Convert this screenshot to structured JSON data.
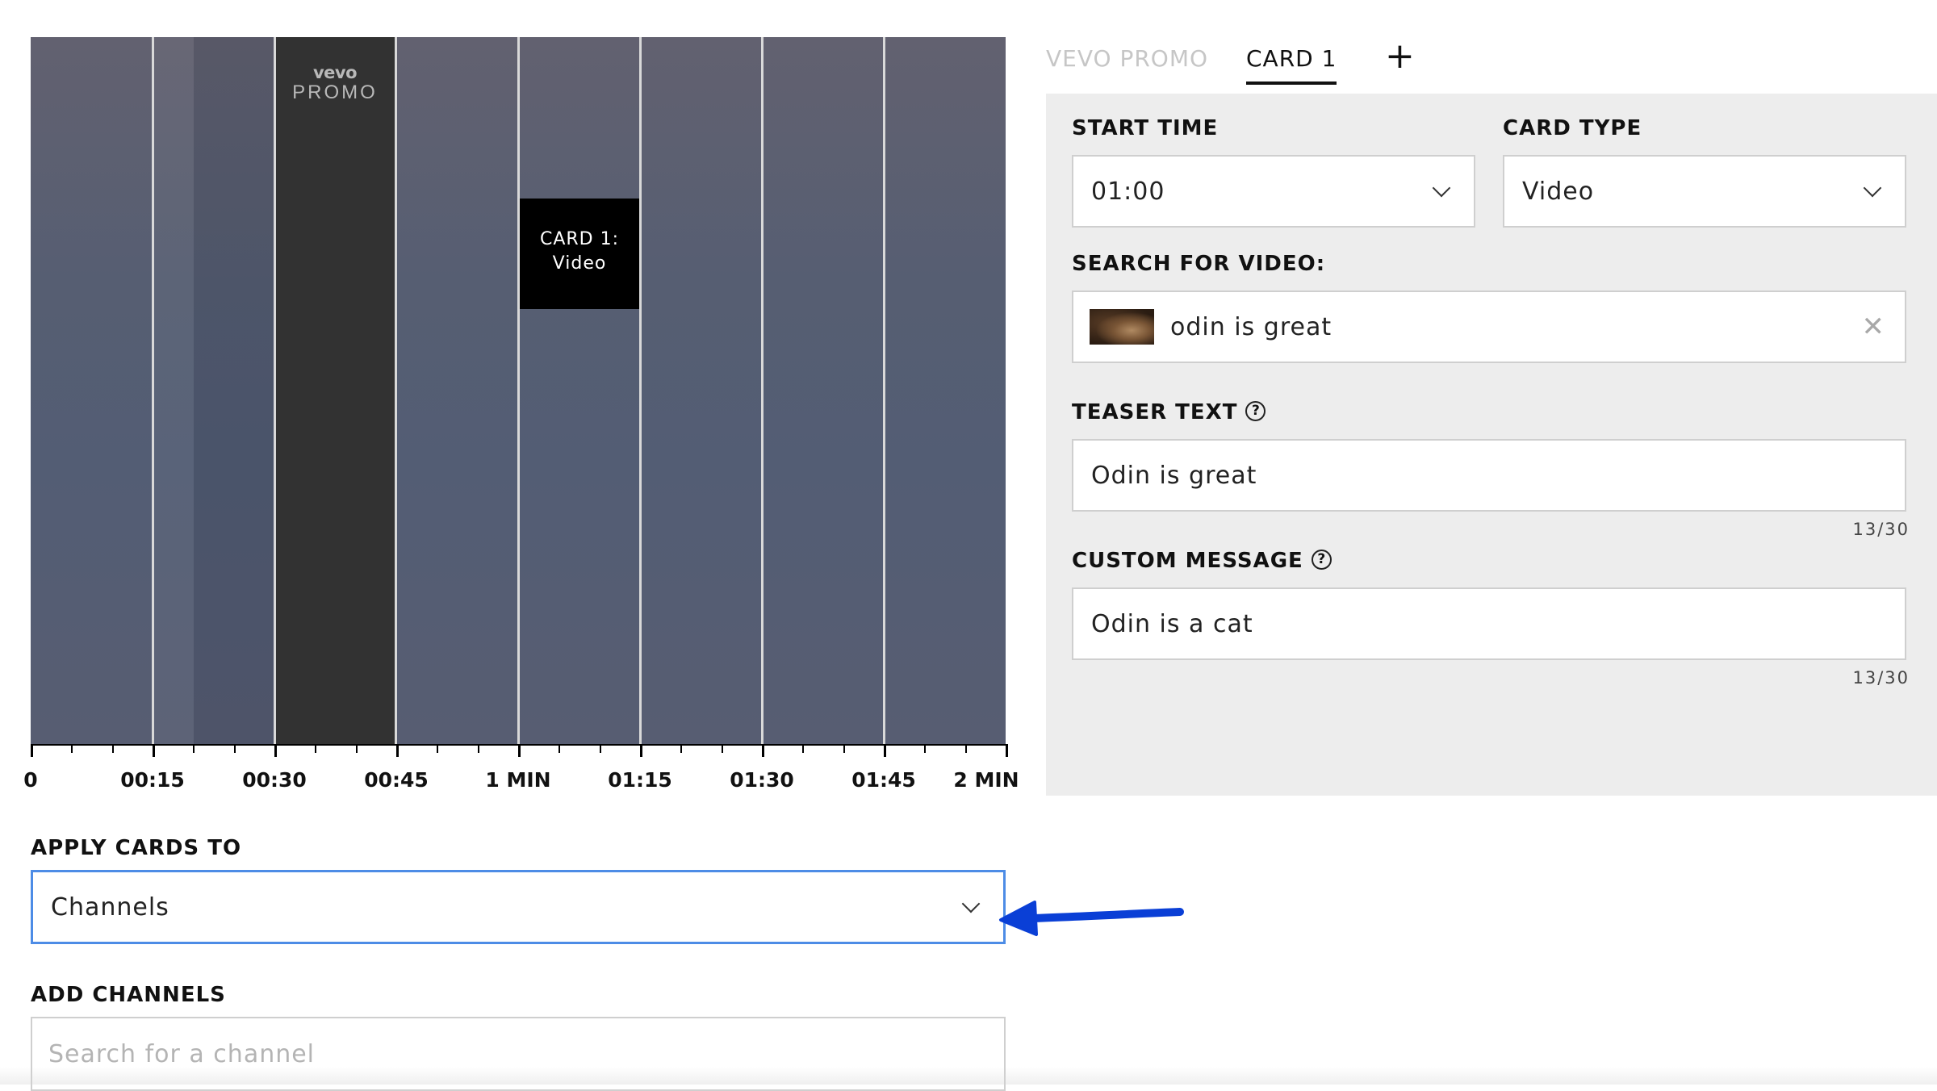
{
  "timeline": {
    "promo_brand": "vevo",
    "promo_word": "PROMO",
    "card_marker_line1": "CARD 1:",
    "card_marker_line2": "Video",
    "ticks": [
      "0",
      "00:15",
      "00:30",
      "00:45",
      "1 MIN",
      "01:15",
      "01:30",
      "01:45",
      "2 MIN"
    ]
  },
  "apply_cards": {
    "label": "APPLY CARDS TO",
    "value": "Channels"
  },
  "add_channels": {
    "label": "ADD CHANNELS",
    "placeholder": "Search for a channel"
  },
  "tabs": {
    "items": [
      {
        "label": "VEVO PROMO",
        "active": false
      },
      {
        "label": "CARD 1",
        "active": true
      }
    ],
    "add_label": "+"
  },
  "card_form": {
    "start_time": {
      "label": "START TIME",
      "value": "01:00"
    },
    "card_type": {
      "label": "CARD TYPE",
      "value": "Video"
    },
    "search_video": {
      "label": "SEARCH FOR VIDEO:",
      "value": "odin is great",
      "clear": "✕"
    },
    "teaser_text": {
      "label": "TEASER TEXT",
      "value": "Odin is great",
      "counter": "13/30",
      "help": "?"
    },
    "custom_message": {
      "label": "CUSTOM MESSAGE",
      "value": "Odin is a cat",
      "counter": "13/30",
      "help": "?"
    }
  },
  "colors": {
    "focus_border": "#4d8ce6",
    "arrow": "#0a3fd6",
    "panel_bg": "#ededed",
    "promo_block": "#323232"
  }
}
